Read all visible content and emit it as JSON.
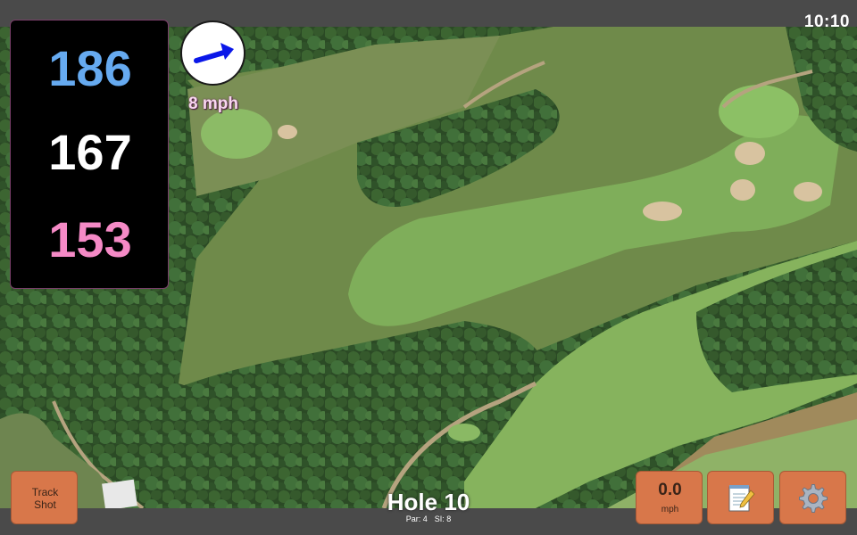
{
  "status": {
    "time": "10:10"
  },
  "distances": {
    "back": "186",
    "middle": "167",
    "front": "153"
  },
  "wind": {
    "speed_label": "8 mph",
    "direction": "northeast-arrow-icon"
  },
  "hole": {
    "title": "Hole 10",
    "par_label": "Par: 4",
    "si_label": "SI: 8"
  },
  "buttons": {
    "track_shot": "Track\nShot",
    "wind_value": "0.0",
    "wind_unit": "mph",
    "notes_icon": "notepad-icon",
    "settings_icon": "gear-icon"
  },
  "colors": {
    "back_distance": "#66aaf0",
    "middle_distance": "#ffffff",
    "front_distance": "#f58ac6",
    "button": "#d8774a"
  }
}
